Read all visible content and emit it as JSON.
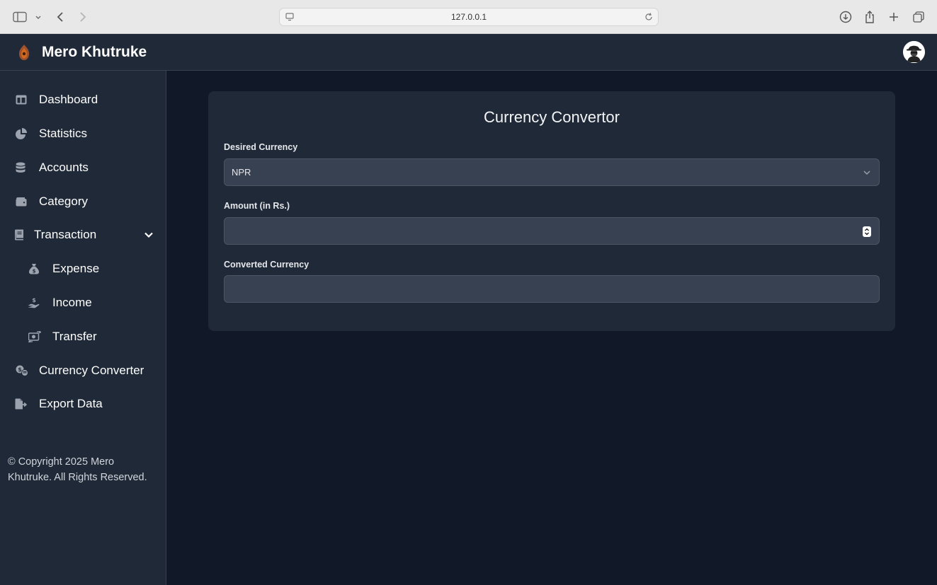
{
  "browser": {
    "url": "127.0.0.1"
  },
  "app": {
    "title": "Mero Khutruke"
  },
  "sidebar": {
    "items": [
      {
        "label": "Dashboard",
        "icon": "dashboard-icon"
      },
      {
        "label": "Statistics",
        "icon": "pie-chart-icon"
      },
      {
        "label": "Accounts",
        "icon": "database-icon"
      },
      {
        "label": "Category",
        "icon": "wallet-icon"
      },
      {
        "label": "Transaction",
        "icon": "book-icon"
      },
      {
        "label": "Expense",
        "icon": "money-bag-icon"
      },
      {
        "label": "Income",
        "icon": "hand-coin-icon"
      },
      {
        "label": "Transfer",
        "icon": "money-transfer-icon"
      },
      {
        "label": "Currency Converter",
        "icon": "currency-exchange-icon"
      },
      {
        "label": "Export Data",
        "icon": "file-export-icon"
      }
    ],
    "copyright": "© Copyright 2025 Mero Khutruke. All Rights Reserved."
  },
  "converter": {
    "title": "Currency Convertor",
    "desired_label": "Desired Currency",
    "desired_value": "NPR",
    "amount_label": "Amount (in Rs.)",
    "amount_value": "",
    "converted_label": "Converted Currency",
    "converted_value": ""
  }
}
